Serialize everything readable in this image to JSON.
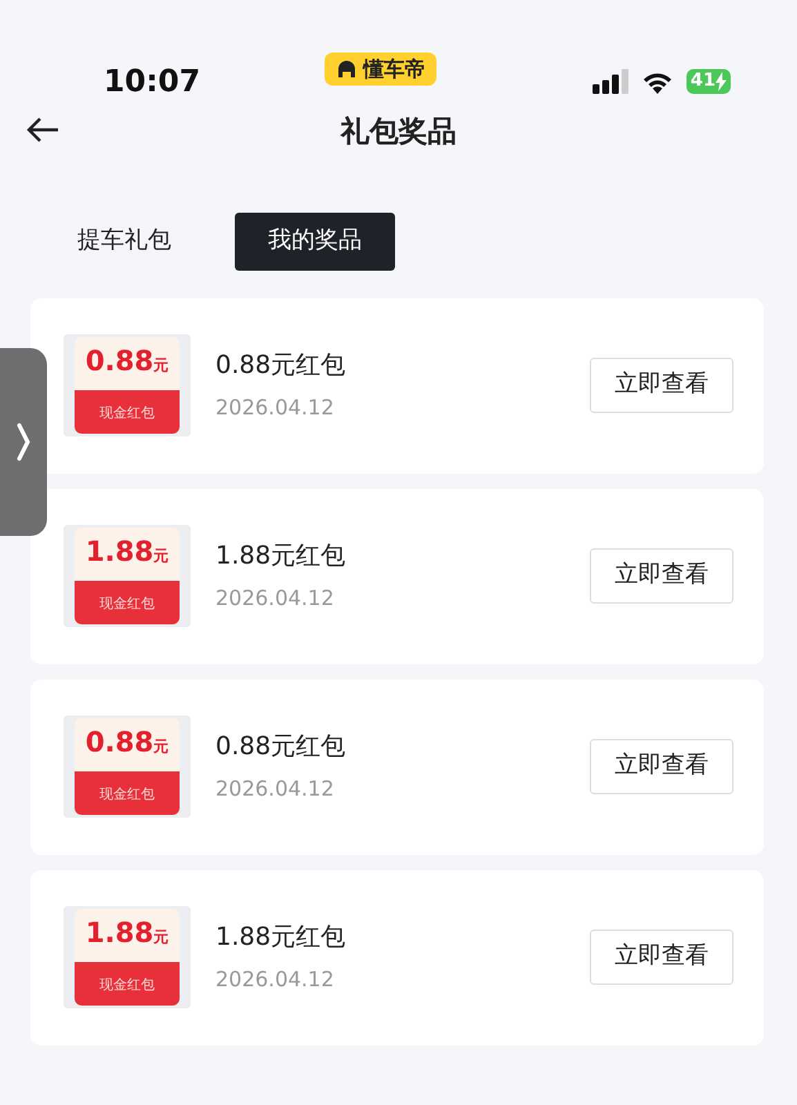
{
  "status_bar": {
    "time": "10:07",
    "app_badge": "懂车帝",
    "battery": "41"
  },
  "nav": {
    "title": "礼包奖品"
  },
  "tabs": [
    {
      "label": "提车礼包",
      "selected": false
    },
    {
      "label": "我的奖品",
      "selected": true
    }
  ],
  "prizes": [
    {
      "amount": "0.88",
      "unit": "元",
      "coupon_label": "现金红包",
      "name": "0.88元红包",
      "date": "2026.04.12",
      "button": "立即查看"
    },
    {
      "amount": "1.88",
      "unit": "元",
      "coupon_label": "现金红包",
      "name": "1.88元红包",
      "date": "2026.04.12",
      "button": "立即查看"
    },
    {
      "amount": "0.88",
      "unit": "元",
      "coupon_label": "现金红包",
      "name": "0.88元红包",
      "date": "2026.04.12",
      "button": "立即查看"
    },
    {
      "amount": "1.88",
      "unit": "元",
      "coupon_label": "现金红包",
      "name": "1.88元红包",
      "date": "2026.04.12",
      "button": "立即查看"
    }
  ]
}
